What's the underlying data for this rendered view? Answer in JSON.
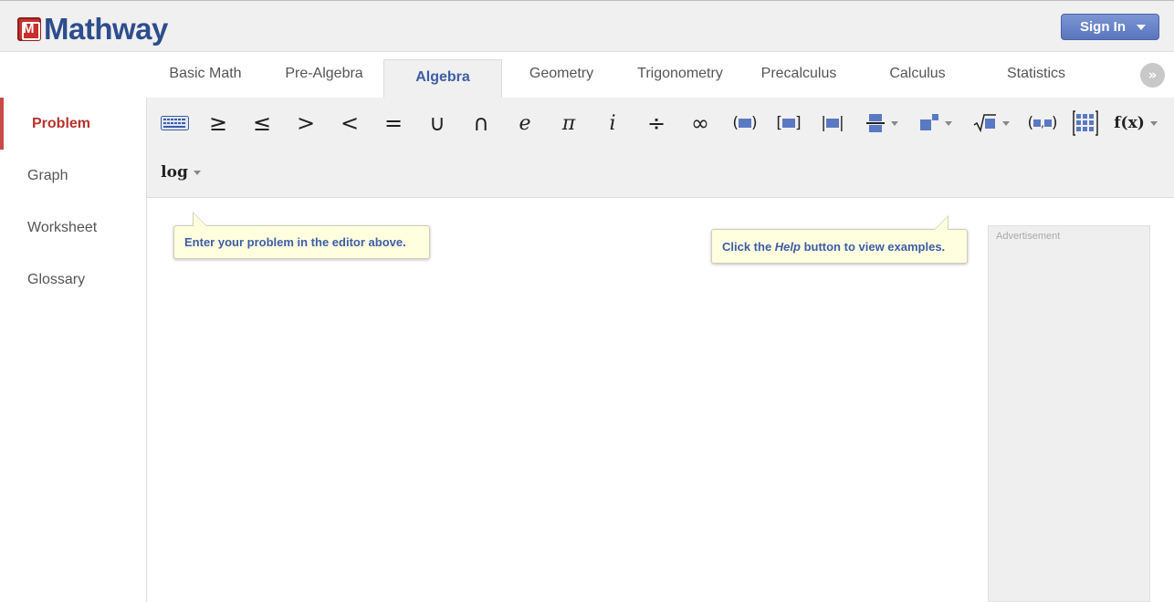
{
  "header": {
    "logo_text": "Mathway",
    "signin_label": "Sign In"
  },
  "tabs": [
    {
      "label": "Basic Math"
    },
    {
      "label": "Pre-Algebra"
    },
    {
      "label": "Algebra",
      "active": true
    },
    {
      "label": "Geometry"
    },
    {
      "label": "Trigonometry"
    },
    {
      "label": "Precalculus"
    },
    {
      "label": "Calculus"
    },
    {
      "label": "Statistics"
    }
  ],
  "more_tabs_icon": "»",
  "sidebar": {
    "items": [
      {
        "label": "Problem",
        "active": true
      },
      {
        "label": "Graph"
      },
      {
        "label": "Worksheet"
      },
      {
        "label": "Glossary"
      }
    ]
  },
  "toolbar": {
    "symbols": [
      "≥",
      "≤",
      ">",
      "<",
      "=",
      "∪",
      "∩",
      "e",
      "π",
      "i",
      "÷",
      "∞"
    ],
    "fx_label": "f(x)",
    "log_label": "log"
  },
  "tips": {
    "editor": "Enter your problem in the editor above.",
    "help_prefix": "Click the ",
    "help_word": "Help",
    "help_suffix": " button to view examples."
  },
  "ad": {
    "label": "Advertisement"
  },
  "colors": {
    "brand_blue": "#2d4d8c",
    "accent_red": "#c94a46",
    "active_tab": "#3d5da5"
  }
}
